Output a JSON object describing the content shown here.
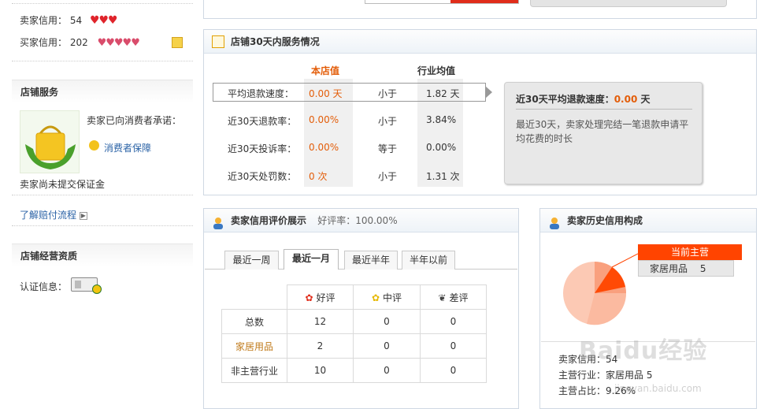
{
  "credit": {
    "seller_label": "卖家信用：",
    "seller_value": "54",
    "seller_hearts": "♥♥♥",
    "buyer_label": "买家信用：",
    "buyer_value": "202",
    "buyer_hearts": "♥♥♥♥♥"
  },
  "shop_service": {
    "title": "店铺服务",
    "promise": "卖家已向消费者承诺：",
    "guarantee_link": "消费者保障",
    "deposit_note": "卖家尚未提交保证金",
    "compensation_link": "了解赔付流程"
  },
  "shop_qual": {
    "title": "店铺经营资质",
    "cert_label": "认证信息："
  },
  "service30": {
    "title": "店铺30天内服务情况",
    "col_shop": "本店值",
    "col_industry": "行业均值",
    "rows": [
      {
        "label": "平均退款速度：",
        "shop": "0.00 天",
        "cmp": "小于",
        "industry": "1.82 天"
      },
      {
        "label": "近30天退款率：",
        "shop": "0.00%",
        "cmp": "小于",
        "industry": "3.84%"
      },
      {
        "label": "近30天投诉率：",
        "shop": "0.00%",
        "cmp": "等于",
        "industry": "0.00%"
      },
      {
        "label": "近30天处罚数：",
        "shop": "0 次",
        "cmp": "小于",
        "industry": "1.31 次"
      }
    ],
    "tip_title_prefix": "近30天平均退款速度：",
    "tip_title_value": "0.00",
    "tip_title_unit": "天",
    "tip_desc": "最近30天，卖家处理完结一笔退款申请平均花费的时长"
  },
  "rating": {
    "title": "卖家信用评价展示",
    "good_rate": "好评率：100.00%",
    "tabs": [
      "最近一周",
      "最近一月",
      "最近半年",
      "半年以前"
    ],
    "active_tab": 1,
    "headers": [
      "好评",
      "中评",
      "差评"
    ],
    "rows": [
      {
        "label": "总数",
        "good": "12",
        "mid": "0",
        "bad": "0"
      },
      {
        "label": "家居用品",
        "good": "2",
        "mid": "0",
        "bad": "0"
      },
      {
        "label": "非主营行业",
        "good": "10",
        "mid": "0",
        "bad": "0"
      }
    ]
  },
  "history": {
    "title": "卖家历史信用构成",
    "current_main_label": "当前主营",
    "main_category": "家居用品",
    "main_count": "5",
    "seller_credit": "卖家信用：54",
    "main_industry": "主营行业：家居用品  5",
    "main_ratio": "主营占比：9.26%",
    "colors": {
      "accent": "#ff4400",
      "slice_main": "#ff4a05",
      "slice_a": "#f9a07e",
      "slice_b": "#fbbaa0",
      "slice_c": "#fcc9b4"
    }
  },
  "watermark": "Baidu经验",
  "watermark_url": "jingyan.baidu.com"
}
